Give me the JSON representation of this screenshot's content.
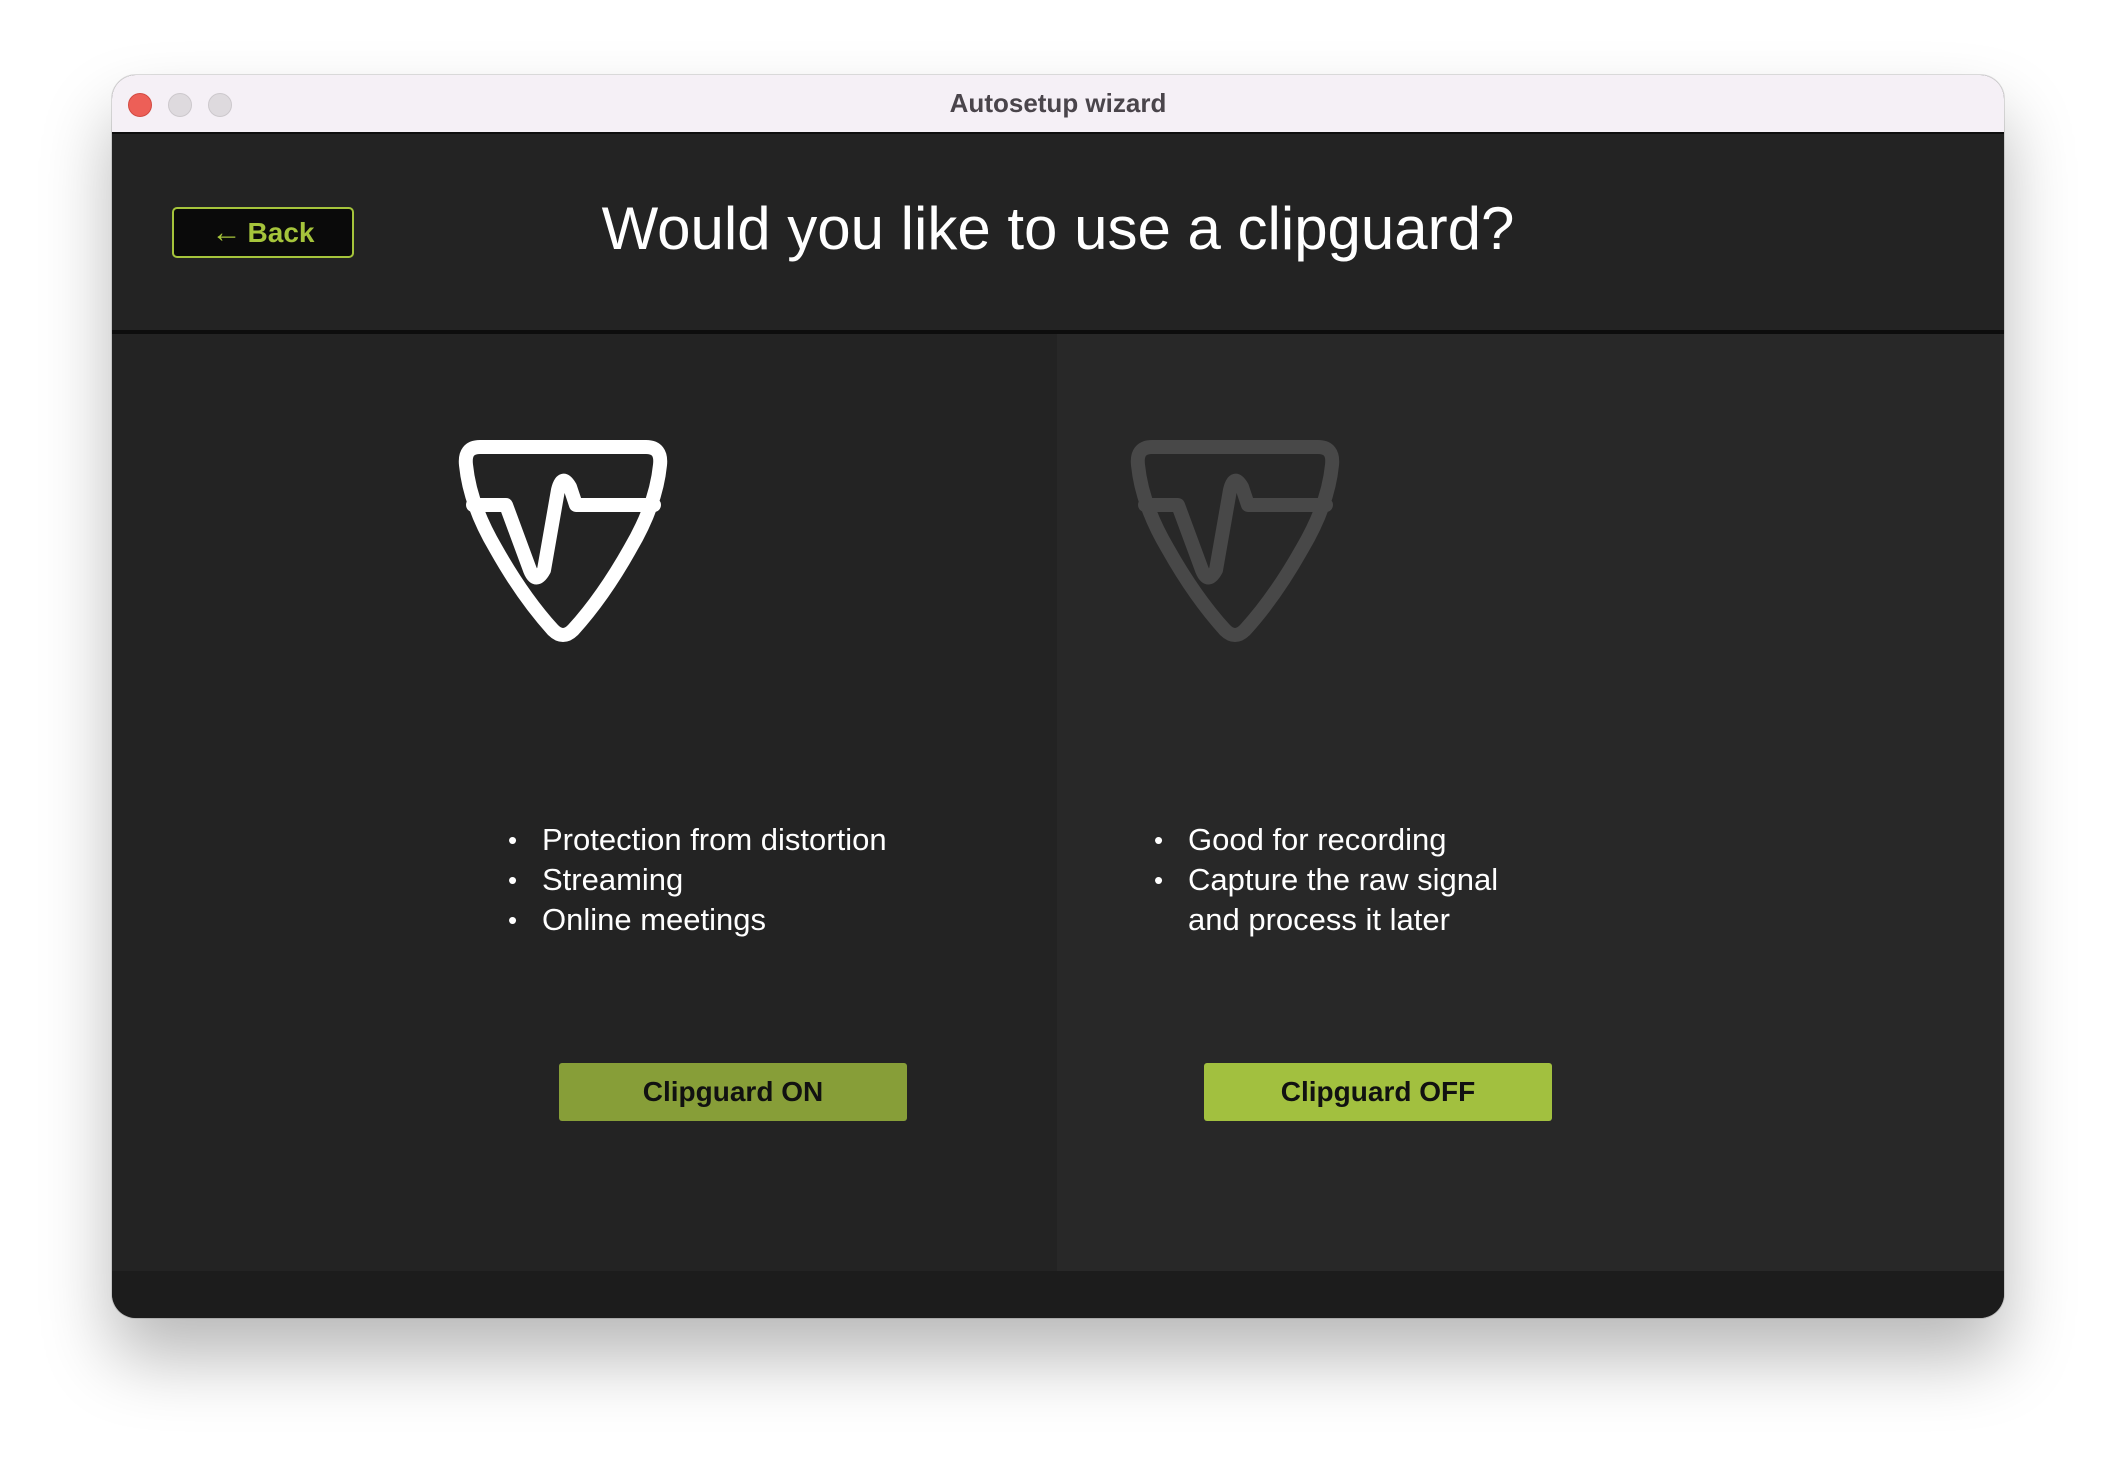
{
  "window": {
    "title": "Autosetup wizard"
  },
  "header": {
    "back_arrow": "←",
    "back_label": "Back",
    "title": "Would you like to use a clipguard?"
  },
  "options": {
    "on": {
      "icon": "clipguard-shield-icon",
      "icon_color": "#ffffff",
      "features": [
        "Protection from distortion",
        "Streaming",
        "Online meetings"
      ],
      "button_label": "Clipguard ON",
      "button_color": "#879e38"
    },
    "off": {
      "icon": "clipguard-shield-icon",
      "icon_color": "#484848",
      "features": [
        "Good for recording",
        "Capture the raw signal",
        "and process it later"
      ],
      "button_label": "Clipguard OFF",
      "button_color": "#a2c03f"
    }
  },
  "colors": {
    "accent": "#a5c43b",
    "background": "#232323",
    "panel_right": "#282828"
  }
}
